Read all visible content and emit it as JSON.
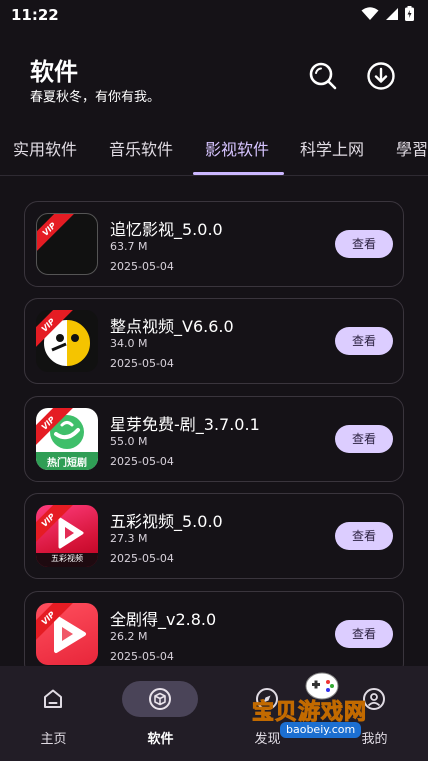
{
  "status": {
    "time": "11:22"
  },
  "header": {
    "title": "软件",
    "subtitle": "春夏秋冬，有你有我。"
  },
  "tabs": [
    {
      "label": "实用软件"
    },
    {
      "label": "音乐软件"
    },
    {
      "label": "影视软件",
      "active": true
    },
    {
      "label": "科学上网"
    },
    {
      "label": "學習"
    }
  ],
  "apps": [
    {
      "name": "追忆影视_5.0.0",
      "size": "63.7 M",
      "date": "2025-05-04",
      "badge": "VIP",
      "button": "查看"
    },
    {
      "name": "整点视频_V6.6.0",
      "size": "34.0 M",
      "date": "2025-05-04",
      "badge": "VIP",
      "button": "查看"
    },
    {
      "name": "星芽免费-剧_3.7.0.1",
      "size": "55.0 M",
      "date": "2025-05-04",
      "badge": "VIP",
      "button": "查看",
      "icon_caption": "热门短剧"
    },
    {
      "name": "五彩视频_5.0.0",
      "size": "27.3 M",
      "date": "2025-05-04",
      "badge": "VIP",
      "button": "查看",
      "icon_caption": "五彩视频"
    },
    {
      "name": "全剧得_v2.8.0",
      "size": "26.2 M",
      "date": "2025-05-04",
      "badge": "VIP",
      "button": "查看"
    }
  ],
  "nav": [
    {
      "label": "主页",
      "icon": "home-icon"
    },
    {
      "label": "软件",
      "icon": "cube-icon",
      "active": true
    },
    {
      "label": "发现",
      "icon": "compass-icon"
    },
    {
      "label": "我的",
      "icon": "person-icon"
    }
  ],
  "watermark": {
    "title": "宝贝游戏网",
    "url": "baobeiy.com"
  },
  "colors": {
    "background": "#151217",
    "accent": "#cbb7ff",
    "button_bg": "#dccdff",
    "vip_red": "#e51c23",
    "nav_bg": "#221d26"
  }
}
